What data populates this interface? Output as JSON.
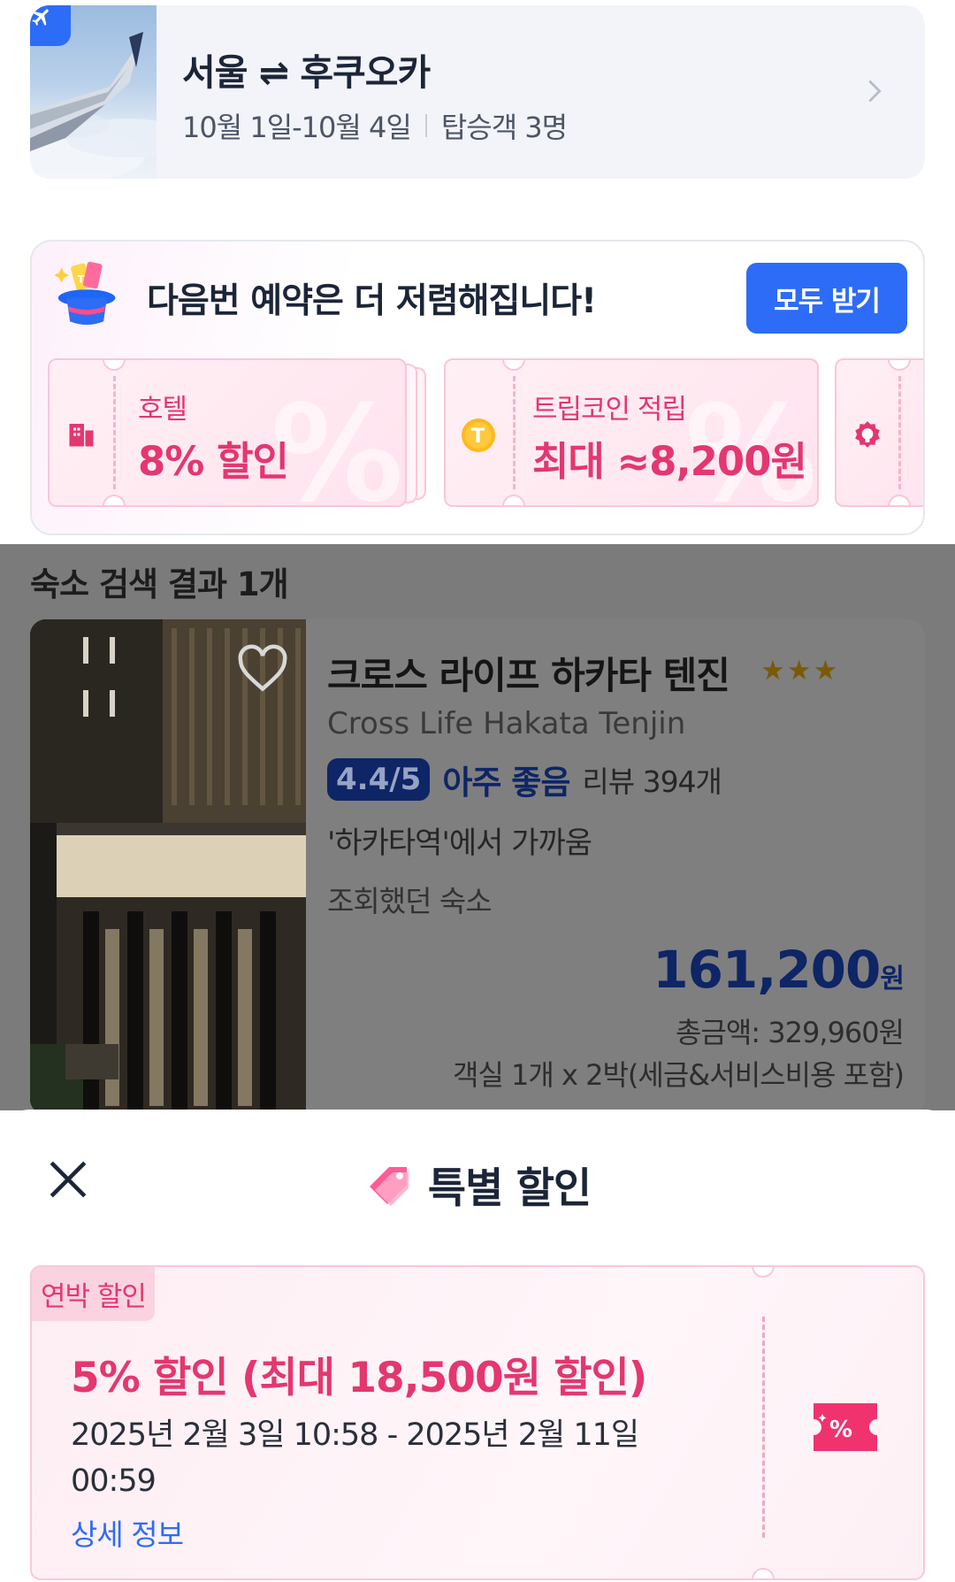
{
  "flight": {
    "route": "서울 ⇌ 후쿠오카",
    "dates": "10월 1일-10월 4일",
    "passengers": "탑승객 3명"
  },
  "promo": {
    "title": "다음번 예약은 더 저렴해집니다!",
    "get_all_button": "모두 받기",
    "coupons": [
      {
        "label": "호텔",
        "value": "8% 할인",
        "icon": "building-icon"
      },
      {
        "label": "트립코인 적립",
        "value": "최대 ≈8,200원",
        "icon": "trip-coin-icon"
      },
      {
        "label": "",
        "value": "",
        "icon": "gear-badge-icon"
      }
    ]
  },
  "results": {
    "count_text": "숙소 검색 결과 1개"
  },
  "hotel": {
    "name": "크로스 라이프 하카타 텐진",
    "stars": "★★★",
    "name_en": "Cross Life Hakata Tenjin",
    "score": "4.4/5",
    "score_word": "아주 좋음",
    "reviews": "리뷰 394개",
    "nearby": "'하카타역'에서 가까움",
    "viewed": "조회했던 숙소",
    "price": "161,200",
    "price_unit": "원",
    "total": "총금액: 329,960원",
    "stay_info": "객실 1개 x 2박(세금&서비스비용 포함)"
  },
  "sheet": {
    "title": "특별 할인",
    "deal": {
      "tag": "연박 할인",
      "headline": "5% 할인 (최대 18,500원 할인)",
      "period": "2025년 2월 3일 10:58 - 2025년 2월 11일 00:59",
      "details_link": "상세 정보"
    }
  },
  "colors": {
    "accent_blue": "#2d6cf6",
    "promo_pink": "#e4376f",
    "navy": "#0e2566"
  }
}
